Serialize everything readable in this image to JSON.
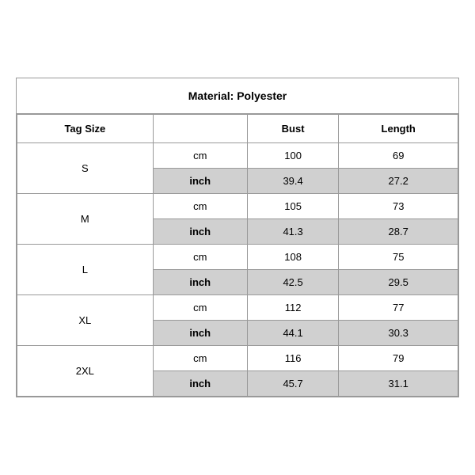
{
  "title": "Material: Polyester",
  "headers": {
    "tag_size": "Tag Size",
    "bust": "Bust",
    "length": "Length"
  },
  "sizes": [
    {
      "tag": "S",
      "rows": [
        {
          "unit": "cm",
          "bust": "100",
          "length": "69",
          "shaded": false
        },
        {
          "unit": "inch",
          "bust": "39.4",
          "length": "27.2",
          "shaded": true
        }
      ]
    },
    {
      "tag": "M",
      "rows": [
        {
          "unit": "cm",
          "bust": "105",
          "length": "73",
          "shaded": false
        },
        {
          "unit": "inch",
          "bust": "41.3",
          "length": "28.7",
          "shaded": true
        }
      ]
    },
    {
      "tag": "L",
      "rows": [
        {
          "unit": "cm",
          "bust": "108",
          "length": "75",
          "shaded": false
        },
        {
          "unit": "inch",
          "bust": "42.5",
          "length": "29.5",
          "shaded": true
        }
      ]
    },
    {
      "tag": "XL",
      "rows": [
        {
          "unit": "cm",
          "bust": "112",
          "length": "77",
          "shaded": false
        },
        {
          "unit": "inch",
          "bust": "44.1",
          "length": "30.3",
          "shaded": true
        }
      ]
    },
    {
      "tag": "2XL",
      "rows": [
        {
          "unit": "cm",
          "bust": "116",
          "length": "79",
          "shaded": false
        },
        {
          "unit": "inch",
          "bust": "45.7",
          "length": "31.1",
          "shaded": true
        }
      ]
    }
  ]
}
